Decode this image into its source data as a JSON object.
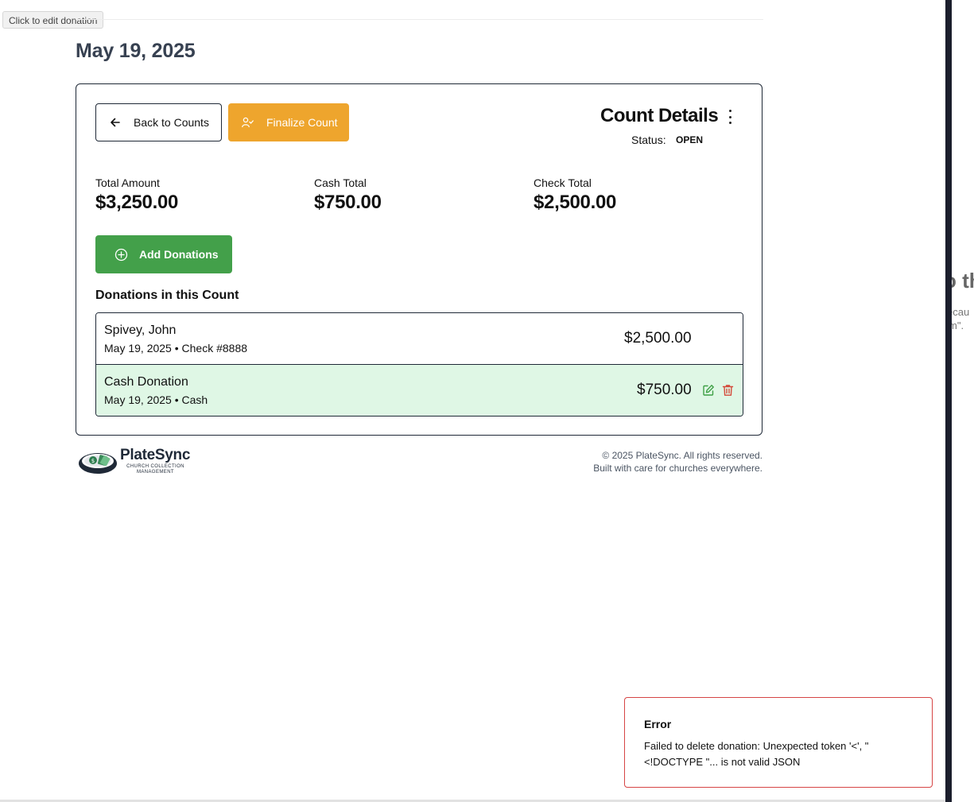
{
  "tooltip": "Click to edit donation",
  "page": {
    "date_heading": "May 19, 2025"
  },
  "toolbar": {
    "back_label": "Back to Counts",
    "finalize_label": "Finalize Count"
  },
  "count": {
    "title": "Count Details",
    "status_label": "Status:",
    "status_value": "OPEN"
  },
  "stats": [
    {
      "label": "Total Amount",
      "value": "$3,250.00"
    },
    {
      "label": "Cash Total",
      "value": "$750.00"
    },
    {
      "label": "Check Total",
      "value": "$2,500.00"
    }
  ],
  "add_button": {
    "label": "Add Donations"
  },
  "donations": {
    "section_title": "Donations in this Count",
    "items": [
      {
        "donor": "Spivey, John",
        "meta": "May 19, 2025 • Check #8888",
        "amount": "$2,500.00"
      },
      {
        "donor": "Cash Donation",
        "meta": "May 19, 2025 • Cash",
        "amount": "$750.00"
      }
    ]
  },
  "logo": {
    "name": "PlateSync",
    "tagline_1": "CHURCH COLLECTION",
    "tagline_2": "MANAGEMENT"
  },
  "footer": {
    "copyright": "© 2025 PlateSync. All rights reserved.",
    "tagline": "Built with care for churches everywhere."
  },
  "side_panel": {
    "line1": "o th",
    "line2": "ecau",
    "line3": "m\"."
  },
  "toast": {
    "title": "Error",
    "message": "Failed to delete donation: Unexpected token '<', \"<!DOCTYPE \"... is not valid JSON"
  },
  "colors": {
    "finalize": "#eea52d",
    "add": "#43a04a",
    "highlight_row": "#dff7e5",
    "edit_icon": "#3fa046",
    "delete_icon": "#d44a3a",
    "toast_border": "#d64545"
  },
  "icons": [
    "arrow-left-icon",
    "user-check-icon",
    "more-vertical-icon",
    "plus-circle-icon",
    "edit-icon",
    "trash-icon",
    "platesync-logo-icon"
  ]
}
